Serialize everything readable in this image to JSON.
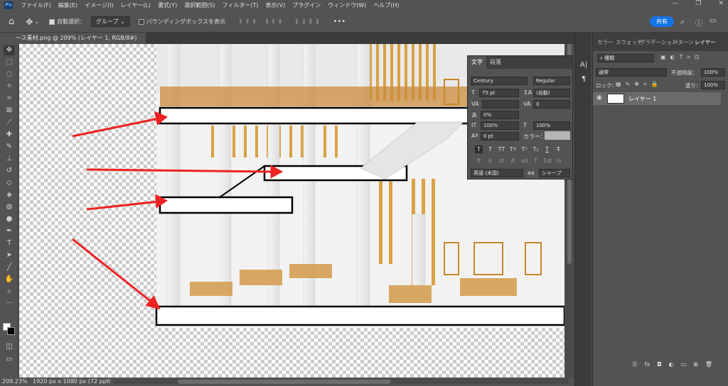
{
  "app": {
    "logo": "Ps"
  },
  "menu": [
    "ファイル(F)",
    "編集(E)",
    "イメージ(I)",
    "レイヤー(L)",
    "書式(Y)",
    "選択範囲(S)",
    "フィルター(T)",
    "表示(V)",
    "プラグイン",
    "ウィンドウ(W)",
    "ヘルプ(H)"
  ],
  "window_buttons": [
    "—",
    "❐",
    "✕"
  ],
  "options": {
    "auto_select_label": "自動選択：",
    "auto_select_value": "グループ",
    "bbox_label": "バウンディングボックスを表示",
    "more": "•••",
    "share": "共有"
  },
  "document_tab": "ース素材.png @ 209% (レイヤー 1, RGB/8#)",
  "tools": [
    "move-tool",
    "marquee-tool",
    "lasso-tool",
    "magic-wand-tool",
    "crop-tool",
    "frame-tool",
    "eyedropper-tool",
    "healing-tool",
    "brush-tool",
    "stamp-tool",
    "history-brush-tool",
    "eraser-tool",
    "fill-tool",
    "blur-tool",
    "dodge-tool",
    "pen-tool",
    "type-tool",
    "path-select-tool",
    "line-tool",
    "hand-tool",
    "zoom-tool",
    "more-tools"
  ],
  "status": {
    "zoom": "209.23%",
    "doc_info": "1920 px x 1080 px (72 ppi)"
  },
  "character_panel": {
    "tabs": [
      "文字",
      "段落"
    ],
    "font_family": "Century",
    "font_style": "Regular",
    "font_size": "75 pt",
    "leading": "(自動)",
    "tracking": "0",
    "scale_percent": "0%",
    "vertical_scale": "100%",
    "horizontal_scale": "100%",
    "baseline": "0 pt",
    "color_label": "カラー：",
    "language": "英語 (米国)",
    "antialias_icon": "aa",
    "antialias": "シャープ",
    "style_buttons": [
      "T",
      "T",
      "TT",
      "Tт",
      "T¹",
      "T₁",
      "T",
      "T̶"
    ],
    "opentype_buttons": [
      "fi",
      "ơ",
      "st",
      "A",
      "ad",
      "T",
      "1st",
      "½"
    ]
  },
  "layers_panel": {
    "tabs": [
      "カラー",
      "スウォッチ",
      "グラデーション",
      "パターン",
      "レイヤー"
    ],
    "filter_kind": "種類",
    "blend_mode": "通常",
    "opacity_label": "不透明度：",
    "opacity_value": "100%",
    "lock_label": "ロック：",
    "fill_label": "塗り：",
    "fill_value": "100%",
    "layer_name": "レイヤー 1",
    "bottom_icons": [
      "ⓖ",
      "fx",
      "◘",
      "◐",
      "▭",
      "⊞",
      "🗑"
    ]
  },
  "colors": {
    "ui_bg": "#535353",
    "ui_dark": "#3b3b3b",
    "accent": "#1473e6",
    "annotation_arrow": "#ee2222"
  }
}
